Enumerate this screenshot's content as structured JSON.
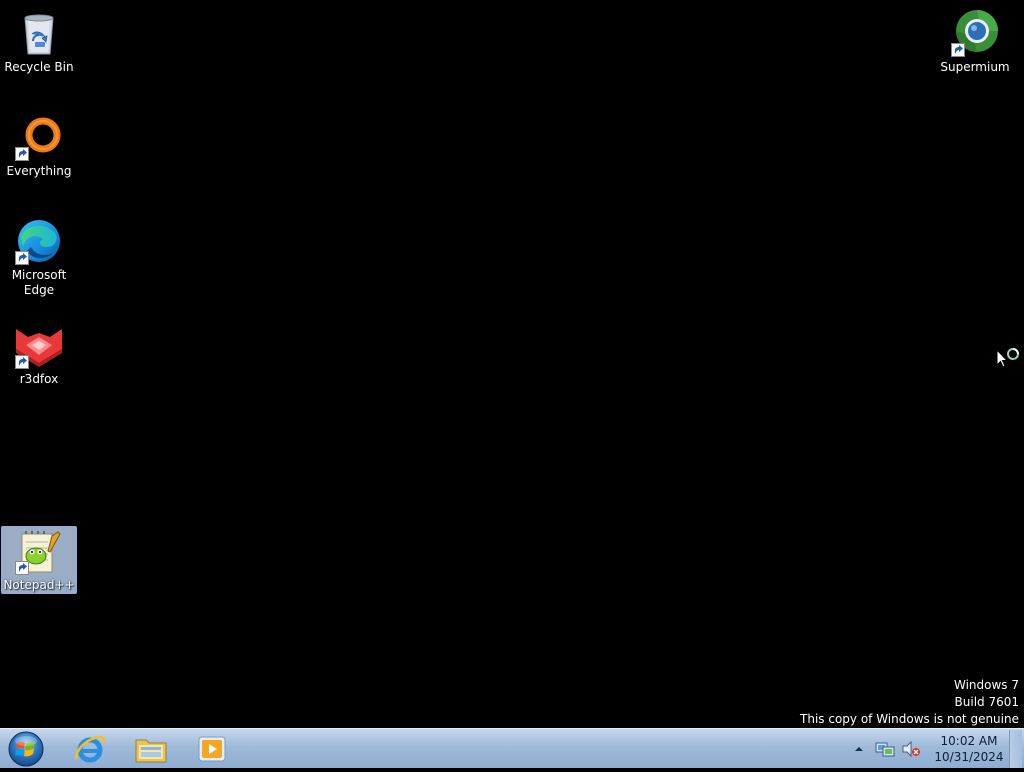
{
  "desktop": {
    "icons": [
      {
        "label": "Recycle Bin",
        "icon": "recycle-bin-icon"
      },
      {
        "label": "Everything",
        "icon": "everything-icon"
      },
      {
        "label": "Microsoft Edge",
        "icon": "edge-icon"
      },
      {
        "label": "r3dfox",
        "icon": "r3dfox-icon"
      },
      {
        "label": "Notepad++",
        "icon": "notepadpp-icon",
        "selected": true
      },
      {
        "label": "Supermium",
        "icon": "supermium-icon"
      }
    ],
    "watermark": {
      "line1": "Windows 7",
      "line2": "Build 7601",
      "line3": "This copy of Windows is not genuine"
    }
  },
  "taskbar": {
    "start": {
      "icon": "windows-orb-icon"
    },
    "pinned": [
      {
        "name": "Internet Explorer",
        "icon": "internet-explorer-icon"
      },
      {
        "name": "Windows Explorer",
        "icon": "file-explorer-icon"
      },
      {
        "name": "Windows Media Player",
        "icon": "media-player-icon"
      }
    ],
    "tray": {
      "show_hidden_icon": "chevron-up-icon",
      "network_icon": "network-icon",
      "volume_icon": "volume-muted-icon"
    },
    "clock": {
      "time": "10:02 AM",
      "date": "10/31/2024"
    }
  },
  "colors": {
    "desktop_bg": "#000000",
    "taskbar_top": "#c6d8ec",
    "taskbar_bottom": "#8fadd2",
    "selection": "#b6cae8"
  }
}
